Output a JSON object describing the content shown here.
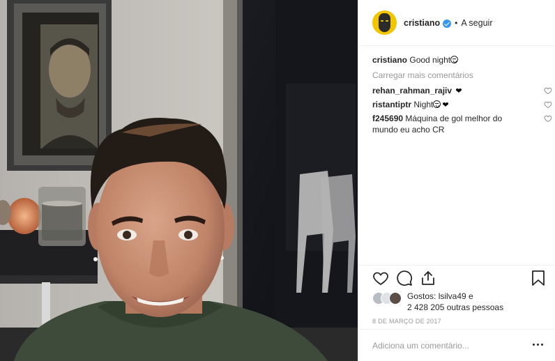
{
  "post": {
    "image_alt": "Selfie photo"
  },
  "header": {
    "username": "cristiano",
    "separator": "•",
    "follow_label": "A seguir"
  },
  "caption": {
    "username": "cristiano",
    "text": "Good night"
  },
  "load_more": "Carregar mais comentários",
  "comments": [
    {
      "username": "rehan_rahman_rajiv",
      "text": ""
    },
    {
      "username": "ristantiptr",
      "text": "Night"
    },
    {
      "username": "f245690",
      "text": "Máquina de gol melhor do mundo eu acho CR"
    }
  ],
  "likes": {
    "prefix": "Gostos: ",
    "user": "lsilva49",
    "connector": " e",
    "count_line": "2 428 205 outras pessoas"
  },
  "date": "8 DE MARÇO DE 2017",
  "add_comment": {
    "placeholder": "Adiciona um comentário..."
  },
  "colors": {
    "verified": "#3897f0",
    "avatar_bg": "#f2c500",
    "muted_text": "#999999",
    "border": "#efefef"
  },
  "icons": [
    "heart-icon",
    "comment-icon",
    "share-icon",
    "bookmark-icon",
    "more-options-icon",
    "verified-badge-icon"
  ]
}
